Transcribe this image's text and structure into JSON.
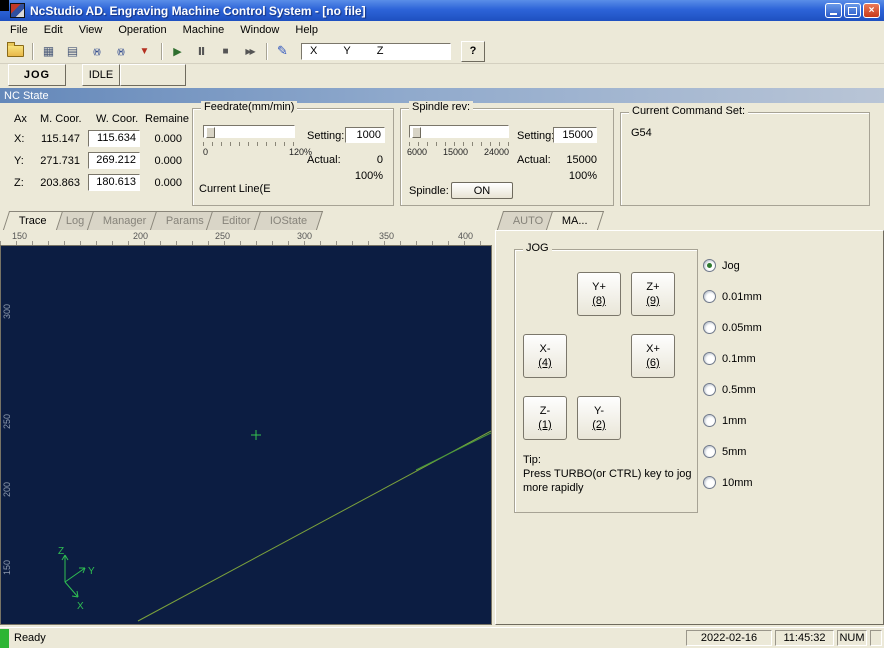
{
  "titlebar": {
    "title": "NcStudio AD. Engraving Machine Control System  - [no file]"
  },
  "menus": [
    "File",
    "Edit",
    "View",
    "Operation",
    "Machine",
    "Window",
    "Help"
  ],
  "toolbar": {
    "xyz": [
      "X",
      "Y",
      "Z"
    ],
    "help": "?"
  },
  "mode": {
    "jog": "JOG",
    "state": "IDLE"
  },
  "nc_state": {
    "header": "NC State"
  },
  "coords": {
    "headers": [
      "Ax",
      "M. Coor.",
      "W. Coor.",
      "Remaine"
    ],
    "rows": [
      {
        "axis": "X:",
        "m": "115.147",
        "w": "115.634",
        "rem": "0.000"
      },
      {
        "axis": "Y:",
        "m": "271.731",
        "w": "269.212",
        "rem": "0.000"
      },
      {
        "axis": "Z:",
        "m": "203.863",
        "w": "180.613",
        "rem": "0.000"
      }
    ]
  },
  "feedrate": {
    "title": "Feedrate(mm/min)",
    "setting_label": "Setting:",
    "setting_value": "1000",
    "scale_min": "0",
    "scale_max": "120%",
    "actual_label": "Actual:",
    "actual_value": "0",
    "percent": "100%",
    "current_line": "Current Line(E"
  },
  "spindle": {
    "title": "Spindle rev:",
    "setting_label": "Setting:",
    "setting_value": "15000",
    "scale": [
      "6000",
      "15000",
      "24000"
    ],
    "actual_label": "Actual:",
    "actual_value": "15000",
    "percent": "100%",
    "spindle_label": "Spindle:",
    "on_label": "ON"
  },
  "command": {
    "title": "Current Command Set:",
    "value": "G54"
  },
  "trace": {
    "tabs": [
      "Trace",
      "Log",
      "Manager",
      "Params",
      "Editor",
      "IOState"
    ],
    "h_ruler": [
      "150",
      "200",
      "250",
      "300",
      "350",
      "400"
    ],
    "v_ruler": [
      "300",
      "250",
      "200",
      "150"
    ],
    "axis": {
      "x": "X",
      "y": "Y",
      "z": "Z"
    }
  },
  "panel": {
    "tabs": [
      "AUTO",
      "MA..."
    ],
    "group_title": "JOG",
    "jog_buttons": [
      {
        "label": "Y+",
        "key": "(8)"
      },
      {
        "label": "Z+",
        "key": "(9)"
      },
      {
        "label": "X-",
        "key": "(4)"
      },
      {
        "label": "X+",
        "key": "(6)"
      },
      {
        "label": "Z-",
        "key": "(1)"
      },
      {
        "label": "Y-",
        "key": "(2)"
      }
    ],
    "steps": [
      "Jog",
      "0.01mm",
      "0.05mm",
      "0.1mm",
      "0.5mm",
      "1mm",
      "5mm",
      "10mm"
    ],
    "tip_label": "Tip:",
    "tip_text": "Press TURBO(or CTRL) key to jog more rapidly"
  },
  "statusbar": {
    "ready": "Ready",
    "date": "2022-02-16",
    "time": "11:45:32",
    "num": "NUM"
  }
}
